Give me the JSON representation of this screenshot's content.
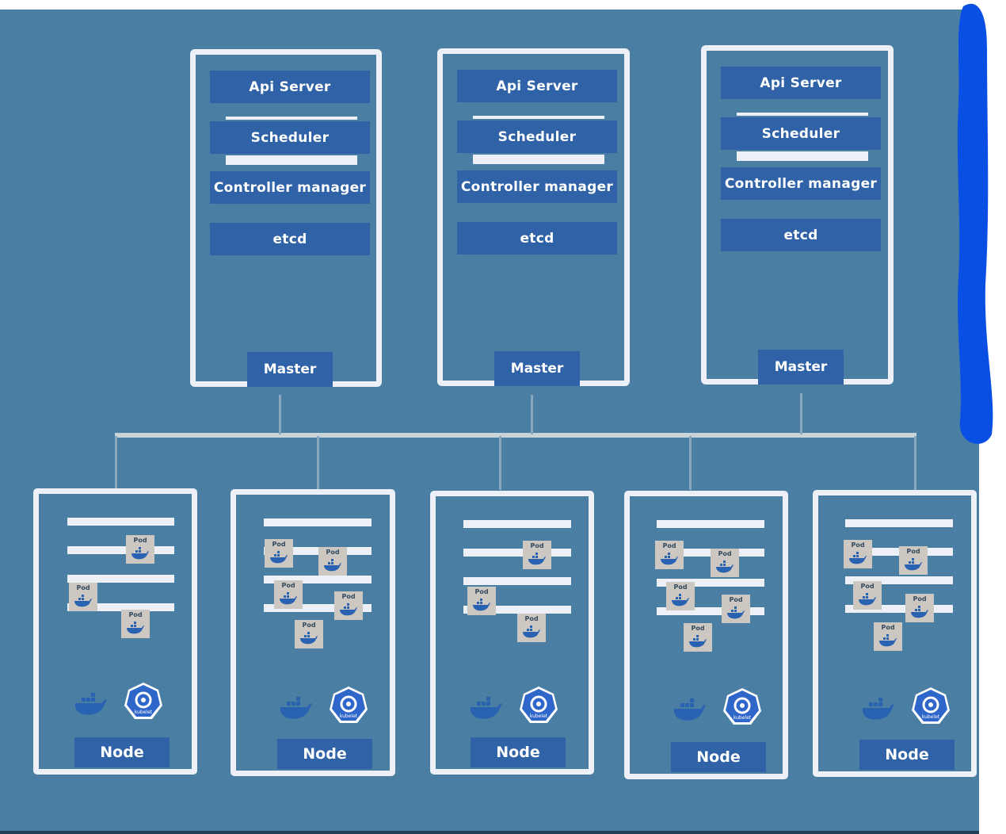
{
  "diagram": {
    "masters": [
      {
        "label": "Master",
        "components": [
          "Api Server",
          "Scheduler",
          "Controller manager",
          "etcd"
        ]
      },
      {
        "label": "Master",
        "components": [
          "Api Server",
          "Scheduler",
          "Controller manager",
          "etcd"
        ]
      },
      {
        "label": "Master",
        "components": [
          "Api Server",
          "Scheduler",
          "Controller manager",
          "etcd"
        ]
      }
    ],
    "nodes": [
      {
        "label": "Node",
        "pod_label": "Pod",
        "kubelet_label": "kubelet"
      },
      {
        "label": "Node",
        "pod_label": "Pod",
        "kubelet_label": "kubelet"
      },
      {
        "label": "Node",
        "pod_label": "Pod",
        "kubelet_label": "kubelet"
      },
      {
        "label": "Node",
        "pod_label": "Pod",
        "kubelet_label": "kubelet"
      },
      {
        "label": "Node",
        "pod_label": "Pod",
        "kubelet_label": "kubelet"
      }
    ],
    "colors": {
      "background": "#4a7ea2",
      "frame": "#eef0f7",
      "component": "#2f62a6",
      "pod": "#ccc8c1",
      "docker": "#2a62b2",
      "kubelet": "#2f66c9",
      "annotation_mark": "#0a4fe3"
    },
    "icons": [
      "docker-whale-icon",
      "kubelet-icon"
    ]
  }
}
